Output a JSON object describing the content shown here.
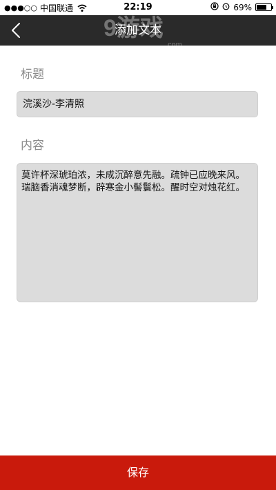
{
  "status_bar": {
    "signal": "●●●○○",
    "carrier": "中国联通",
    "time": "22:19",
    "battery_percent": "69%",
    "battery_level": 0.69
  },
  "nav": {
    "title": "添加文本",
    "back_icon": "chevron-left-icon",
    "watermark_text": "9游戏",
    "watermark_url": ".com"
  },
  "form": {
    "title_label": "标题",
    "title_value": "浣溪沙-李清照",
    "content_label": "内容",
    "content_value": "莫许杯深琥珀浓，未成沉醉意先融。疏钟已应晚来风。瑞脑香消魂梦断，辟寒金小髻鬟松。醒时空对烛花红。"
  },
  "footer": {
    "save_label": "保存"
  },
  "colors": {
    "nav_bg": "#2a2a2a",
    "accent": "#c91a0c",
    "field_bg": "#dcdcdc",
    "label": "#8a8a8a"
  }
}
